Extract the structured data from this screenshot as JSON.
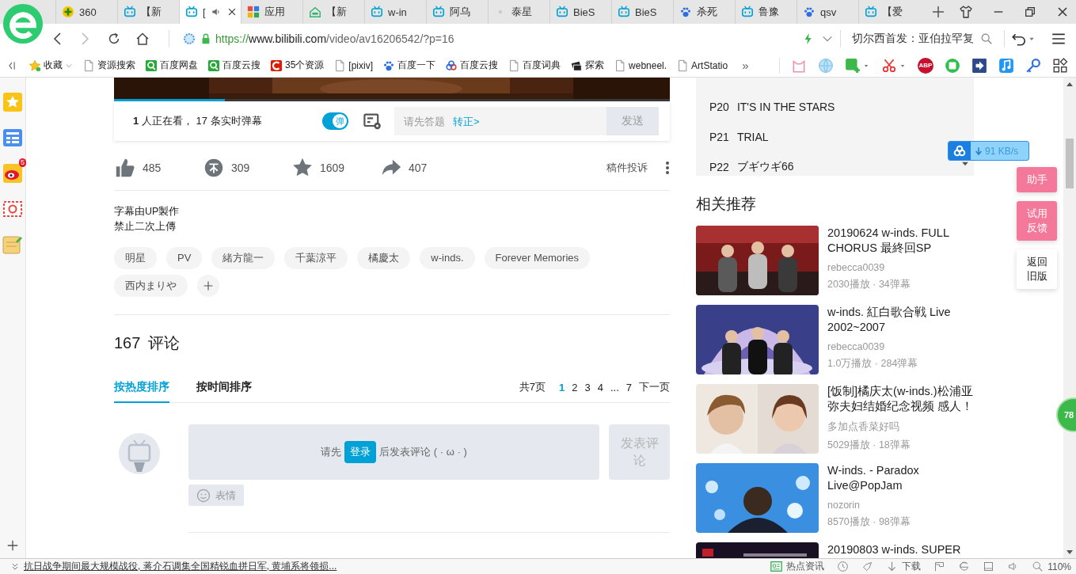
{
  "browser": {
    "tabs": [
      {
        "kind": "badge",
        "title": "360",
        "selected": false,
        "audio": false
      },
      {
        "kind": "tv",
        "title": "【新",
        "selected": false,
        "audio": false
      },
      {
        "kind": "tv",
        "title": "[",
        "selected": true,
        "audio": true
      },
      {
        "kind": "grid",
        "title": "应用",
        "selected": false,
        "audio": false
      },
      {
        "kind": "house",
        "title": "【新",
        "selected": false,
        "audio": false
      },
      {
        "kind": "tv",
        "title": "w-in",
        "selected": false,
        "audio": false
      },
      {
        "kind": "tv",
        "title": "阿乌",
        "selected": false,
        "audio": false
      },
      {
        "kind": "dot",
        "title": "泰星",
        "selected": false,
        "audio": false
      },
      {
        "kind": "tv",
        "title": "BieS",
        "selected": false,
        "audio": false
      },
      {
        "kind": "tv",
        "title": "BieS",
        "selected": false,
        "audio": false
      },
      {
        "kind": "paw",
        "title": "杀死",
        "selected": false,
        "audio": false
      },
      {
        "kind": "tv",
        "title": "鲁豫",
        "selected": false,
        "audio": false
      },
      {
        "kind": "paw",
        "title": "qsv",
        "selected": false,
        "audio": false
      },
      {
        "kind": "tv",
        "title": "【爱",
        "selected": false,
        "audio": false
      }
    ],
    "address": {
      "scheme": "https://",
      "host": "www.bilibili.com",
      "path": "/video/av16206542/?p=16"
    },
    "search": {
      "value": "切尔西首发：亚伯拉罕复"
    },
    "bookmarks": [
      {
        "kind": "star",
        "label": "收藏",
        "menu": true
      },
      {
        "kind": "page",
        "label": "资源搜索",
        "menu": false
      },
      {
        "kind": "q",
        "label": "百度网盘",
        "menu": false
      },
      {
        "kind": "q",
        "label": "百度云搜",
        "menu": false
      },
      {
        "kind": "c",
        "label": "35个资源",
        "menu": false
      },
      {
        "kind": "page",
        "label": "[pixiv]",
        "menu": false
      },
      {
        "kind": "paw",
        "label": "百度一下",
        "menu": false
      },
      {
        "kind": "cloud",
        "label": "百度云搜",
        "menu": false
      },
      {
        "kind": "page",
        "label": "百度词典",
        "menu": false
      },
      {
        "kind": "card",
        "label": "探索",
        "menu": false
      },
      {
        "kind": "page",
        "label": "webneel.",
        "menu": false
      },
      {
        "kind": "page",
        "label": "ArtStatio",
        "menu": false
      }
    ],
    "bookmarks_more": "»",
    "extensions": [
      {
        "kind": "cat",
        "menu": false
      },
      {
        "kind": "globe",
        "menu": false
      },
      {
        "kind": "translate",
        "menu": true
      },
      {
        "kind": "scissors",
        "menu": true
      },
      {
        "kind": "abp",
        "label": "ABP",
        "menu": false
      },
      {
        "kind": "book",
        "menu": false
      },
      {
        "kind": "arrow",
        "menu": false
      },
      {
        "kind": "music",
        "menu": false
      },
      {
        "kind": "key",
        "menu": false
      },
      {
        "kind": "apps",
        "menu": false
      }
    ]
  },
  "side_rail": {
    "items": [
      {
        "kind": "star"
      },
      {
        "kind": "list"
      },
      {
        "kind": "weibo",
        "badge": "5"
      },
      {
        "kind": "mail"
      },
      {
        "kind": "notes"
      }
    ]
  },
  "video": {
    "level": 0.2
  },
  "danmaku": {
    "status": "**1** 人正在看， 17 条实时弹幕",
    "toggle": {
      "label": "弹",
      "on": true
    },
    "input": {
      "placeholder": "请先答题",
      "link": "转正>"
    },
    "send": {
      "label": "发送",
      "disabled": true
    }
  },
  "stats": [
    {
      "kind": "like",
      "count": "485"
    },
    {
      "kind": "coin",
      "count": "309"
    },
    {
      "kind": "favorite",
      "count": "1609"
    },
    {
      "kind": "share",
      "count": "407"
    }
  ],
  "report": "稿件投诉",
  "description": [
    "字幕由UP製作",
    "禁止二次上傳"
  ],
  "tags": [
    "明星",
    "PV",
    "緒方龍一",
    "千葉涼平",
    "橘慶太",
    "w-inds.",
    "Forever Memories",
    "西内まりや"
  ],
  "comments": {
    "count": "167",
    "title": "评论",
    "sort_tabs": [
      {
        "label": "按热度排序",
        "selected": true
      },
      {
        "label": "按时间排序",
        "selected": false
      }
    ],
    "pagination": {
      "total": "共7页",
      "pages": [
        {
          "kind": "page",
          "label": "1",
          "selected": true
        },
        {
          "kind": "page",
          "label": "2",
          "selected": false
        },
        {
          "kind": "page",
          "label": "3",
          "selected": false
        },
        {
          "kind": "page",
          "label": "4",
          "selected": false
        },
        {
          "kind": "ellipsis",
          "label": "..."
        },
        {
          "kind": "page",
          "label": "7",
          "selected": false
        }
      ],
      "next": "下一页"
    }
  },
  "composer": {
    "prompt_before": "请先",
    "login": "登录",
    "prompt_after": "后发表评论 ( · ω · )",
    "post": {
      "label": "发表评论",
      "disabled": true
    },
    "emoji": "表情"
  },
  "playlist": [
    {
      "part": "P20",
      "title": "IT'S IN THE STARS"
    },
    {
      "part": "P21",
      "title": "TRIAL"
    },
    {
      "part": "P22",
      "title": "ブギウギ66"
    }
  ],
  "recommended": {
    "title": "相关推荐",
    "items": [
      {
        "title": "20190624 w-inds. FULL CHORUS 最終回SP",
        "up": "rebecca0039",
        "stats": "2030播放 · 34弹幕"
      },
      {
        "title": "w-inds. 紅白歌合戦 Live 2002~2007",
        "up": "rebecca0039",
        "stats": "1.0万播放 · 284弹幕"
      },
      {
        "title": "[饭制]橘庆太(w-inds.)松浦亚弥夫妇结婚纪念视频 感人！",
        "up": "多加点香菜好吗",
        "stats": "5029播放 · 18弹幕"
      },
      {
        "title": "W-inds. - Paradox Live@PopJam",
        "up": "nozorin",
        "stats": "8570播放 · 98弹幕"
      },
      {
        "title": "20190803 w-inds. SUPER"
      }
    ]
  },
  "floating": {
    "download_speed": "91 KB/s",
    "buttons": [
      {
        "label": "助手",
        "kind": "pink"
      },
      {
        "label": "试用反馈",
        "kind": "pink"
      },
      {
        "label": "返回旧版",
        "kind": "white"
      }
    ],
    "score": "78"
  },
  "status_bar": {
    "news": "抗日战争期间最大规模战役, 蒋介石调集全国精锐血拼日军, 黄埔系将领损...",
    "items": [
      {
        "kind": "news",
        "label": "热点资讯"
      },
      {
        "kind": "clock"
      },
      {
        "kind": "rocket"
      },
      {
        "kind": "download",
        "label": "下载"
      },
      {
        "kind": "flag"
      },
      {
        "kind": "ie"
      },
      {
        "kind": "window"
      },
      {
        "kind": "speaker"
      },
      {
        "kind": "zoom",
        "label": "110%"
      }
    ]
  }
}
